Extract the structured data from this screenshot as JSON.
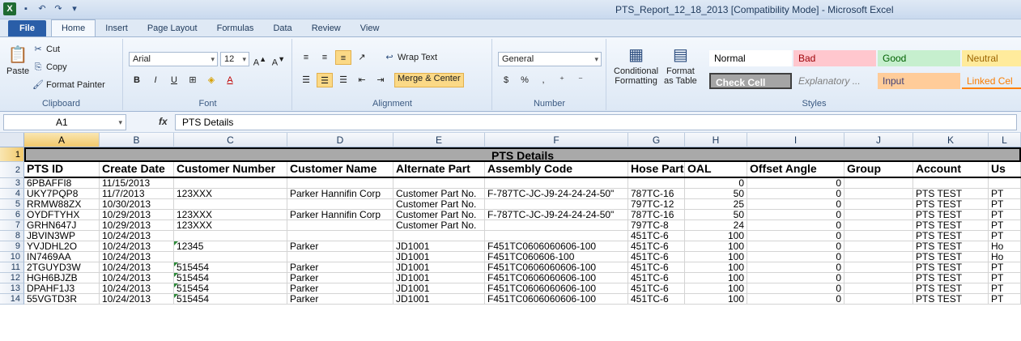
{
  "window": {
    "title": "PTS_Report_12_18_2013  [Compatibility Mode]  -  Microsoft Excel"
  },
  "tabs": [
    "File",
    "Home",
    "Insert",
    "Page Layout",
    "Formulas",
    "Data",
    "Review",
    "View"
  ],
  "ribbon": {
    "clipboard": {
      "paste": "Paste",
      "cut": "Cut",
      "copy": "Copy",
      "format_painter": "Format Painter",
      "label": "Clipboard"
    },
    "font": {
      "name": "Arial",
      "size": "12",
      "label": "Font"
    },
    "alignment": {
      "wrap": "Wrap Text",
      "merge": "Merge & Center",
      "label": "Alignment"
    },
    "number": {
      "format": "General",
      "label": "Number"
    },
    "styles": {
      "conditional": "Conditional",
      "conditional2": "Formatting",
      "format": "Format",
      "format2": "as Table",
      "normal": "Normal",
      "bad": "Bad",
      "good": "Good",
      "neutral": "Neutral",
      "check": "Check Cell",
      "explanatory": "Explanatory ...",
      "input": "Input",
      "linked": "Linked Cel",
      "label": "Styles"
    }
  },
  "formula_bar": {
    "name_box": "A1",
    "fx": "fx",
    "content": "PTS Details"
  },
  "columns": [
    "A",
    "B",
    "C",
    "D",
    "E",
    "F",
    "G",
    "H",
    "I",
    "J",
    "K",
    "L"
  ],
  "sheet": {
    "title": "PTS Details",
    "headers": [
      "PTS ID",
      "Create Date",
      "Customer Number",
      "Customer Name",
      "Alternate Part",
      "Assembly Code",
      "Hose Part",
      "OAL",
      "Offset Angle",
      "Group",
      "Account",
      "Us"
    ],
    "rows": [
      {
        "n": "3",
        "v": [
          "6PBAFFI8",
          "11/15/2013",
          "",
          "",
          "",
          "",
          "",
          "0",
          "0",
          "",
          "",
          ""
        ]
      },
      {
        "n": "4",
        "v": [
          "UKY7PQP8",
          "11/7/2013",
          "123XXX",
          "Parker Hannifin Corp",
          "Customer Part No.",
          "F-787TC-JC-J9-24-24-24-50\"",
          "787TC-16",
          "50",
          "0",
          "",
          "PTS TEST",
          "PT"
        ]
      },
      {
        "n": "5",
        "v": [
          "RRMW88ZX",
          "10/30/2013",
          "",
          "",
          "Customer Part No.",
          "",
          "797TC-12",
          "25",
          "0",
          "",
          "PTS TEST",
          "PT"
        ]
      },
      {
        "n": "6",
        "v": [
          "OYDFTYHX",
          "10/29/2013",
          "123XXX",
          "Parker Hannifin Corp",
          "Customer Part No.",
          "F-787TC-JC-J9-24-24-24-50\"",
          "787TC-16",
          "50",
          "0",
          "",
          "PTS TEST",
          "PT"
        ]
      },
      {
        "n": "7",
        "v": [
          "GRHN647J",
          "10/29/2013",
          "123XXX",
          "",
          "Customer Part No.",
          "",
          "797TC-8",
          "24",
          "0",
          "",
          "PTS TEST",
          "PT"
        ]
      },
      {
        "n": "8",
        "v": [
          "JBVIN3WP",
          "10/24/2013",
          "",
          "",
          "",
          "",
          "451TC-6",
          "100",
          "0",
          "",
          "PTS TEST",
          "PT"
        ]
      },
      {
        "n": "9",
        "v": [
          "YVJDHL2O",
          "10/24/2013",
          "12345",
          "Parker",
          "JD1001",
          "F451TC0606060606-100",
          "451TC-6",
          "100",
          "0",
          "",
          "PTS TEST",
          "Ho"
        ]
      },
      {
        "n": "10",
        "v": [
          "IN7469AA",
          "10/24/2013",
          "",
          "",
          "JD1001",
          "F451TC060606-100",
          "451TC-6",
          "100",
          "0",
          "",
          "PTS TEST",
          "Ho"
        ]
      },
      {
        "n": "11",
        "v": [
          "2TGUYD3W",
          "10/24/2013",
          "515454",
          "Parker",
          "JD1001",
          "F451TC0606060606-100",
          "451TC-6",
          "100",
          "0",
          "",
          "PTS TEST",
          "PT"
        ]
      },
      {
        "n": "12",
        "v": [
          "HGH6BJZB",
          "10/24/2013",
          "515454",
          "Parker",
          "JD1001",
          "F451TC0606060606-100",
          "451TC-6",
          "100",
          "0",
          "",
          "PTS TEST",
          "PT"
        ]
      },
      {
        "n": "13",
        "v": [
          "DPAHF1J3",
          "10/24/2013",
          "515454",
          "Parker",
          "JD1001",
          "F451TC0606060606-100",
          "451TC-6",
          "100",
          "0",
          "",
          "PTS TEST",
          "PT"
        ]
      },
      {
        "n": "14",
        "v": [
          "55VGTD3R",
          "10/24/2013",
          "515454",
          "Parker",
          "JD1001",
          "F451TC0606060606-100",
          "451TC-6",
          "100",
          "0",
          "",
          "PTS TEST",
          "PT"
        ]
      }
    ]
  }
}
